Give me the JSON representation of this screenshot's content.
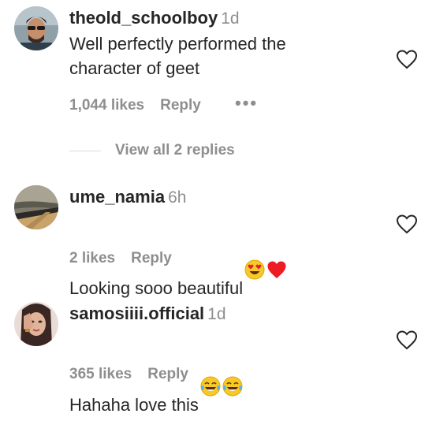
{
  "comments": [
    {
      "username": "theold_schoolboy",
      "time": "1d",
      "text": "Well perfectly performed the\ncharacter of geet",
      "likes": "1,044 likes",
      "reply": "Reply",
      "more": "•••",
      "avatar": "man-with-sunglasses-avatar"
    },
    {
      "username": "ume_namia",
      "time": "6h",
      "text": "Looking sooo beautiful",
      "emojis": [
        "heart-eyes-emoji",
        "red-heart-emoji"
      ],
      "likes": "2 likes",
      "reply": "Reply",
      "avatar": "landscape-road-avatar"
    },
    {
      "username": "samosiiii.official",
      "time": "1d",
      "text": "Hahaha love this",
      "emojis": [
        "tears-of-joy-emoji",
        "tears-of-joy-emoji"
      ],
      "likes": "365 likes",
      "reply": "Reply",
      "avatar": "woman-hand-on-face-avatar"
    }
  ],
  "view_replies": "View all 2 replies",
  "colors": {
    "primary_text": "#262626",
    "secondary_text": "#8e8e8e",
    "divider": "#dbdbdb",
    "heart_red": "#ed1c24"
  }
}
